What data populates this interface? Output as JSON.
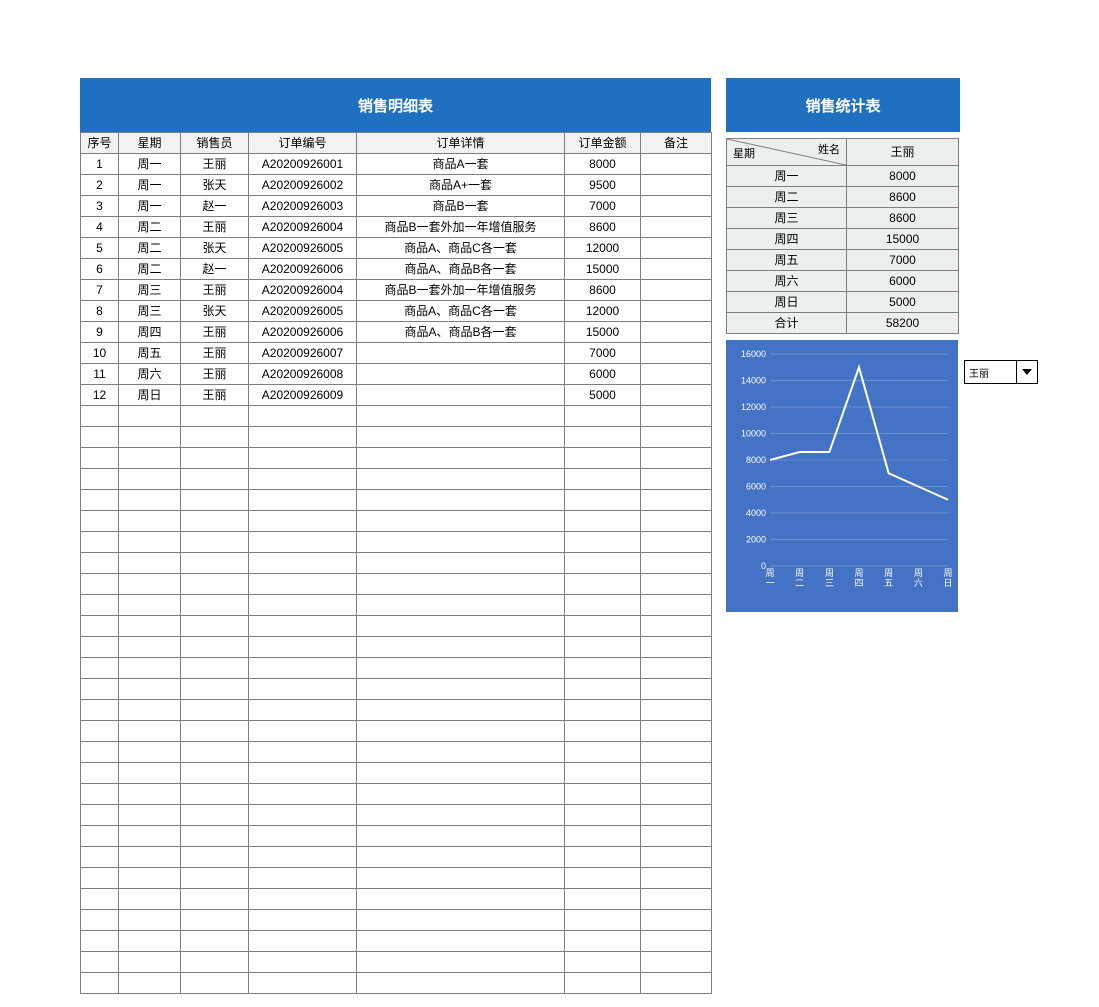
{
  "detail": {
    "title": "销售明细表",
    "headers": [
      "序号",
      "星期",
      "销售员",
      "订单编号",
      "订单详情",
      "订单金额",
      "备注"
    ],
    "rows": [
      {
        "seq": "1",
        "day": "周一",
        "sp": "王丽",
        "ord": "A20200926001",
        "det": "商品A一套",
        "amt": "8000",
        "rem": ""
      },
      {
        "seq": "2",
        "day": "周一",
        "sp": "张天",
        "ord": "A20200926002",
        "det": "商品A+一套",
        "amt": "9500",
        "rem": ""
      },
      {
        "seq": "3",
        "day": "周一",
        "sp": "赵一",
        "ord": "A20200926003",
        "det": "商品B一套",
        "amt": "7000",
        "rem": ""
      },
      {
        "seq": "4",
        "day": "周二",
        "sp": "王丽",
        "ord": "A20200926004",
        "det": "商品B一套外加一年增值服务",
        "amt": "8600",
        "rem": ""
      },
      {
        "seq": "5",
        "day": "周二",
        "sp": "张天",
        "ord": "A20200926005",
        "det": "商品A、商品C各一套",
        "amt": "12000",
        "rem": ""
      },
      {
        "seq": "6",
        "day": "周二",
        "sp": "赵一",
        "ord": "A20200926006",
        "det": "商品A、商品B各一套",
        "amt": "15000",
        "rem": ""
      },
      {
        "seq": "7",
        "day": "周三",
        "sp": "王丽",
        "ord": "A20200926004",
        "det": "商品B一套外加一年增值服务",
        "amt": "8600",
        "rem": ""
      },
      {
        "seq": "8",
        "day": "周三",
        "sp": "张天",
        "ord": "A20200926005",
        "det": "商品A、商品C各一套",
        "amt": "12000",
        "rem": ""
      },
      {
        "seq": "9",
        "day": "周四",
        "sp": "王丽",
        "ord": "A20200926006",
        "det": "商品A、商品B各一套",
        "amt": "15000",
        "rem": ""
      },
      {
        "seq": "10",
        "day": "周五",
        "sp": "王丽",
        "ord": "A20200926007",
        "det": "",
        "amt": "7000",
        "rem": ""
      },
      {
        "seq": "11",
        "day": "周六",
        "sp": "王丽",
        "ord": "A20200926008",
        "det": "",
        "amt": "6000",
        "rem": ""
      },
      {
        "seq": "12",
        "day": "周日",
        "sp": "王丽",
        "ord": "A20200926009",
        "det": "",
        "amt": "5000",
        "rem": ""
      }
    ],
    "empty_rows": 28
  },
  "stats": {
    "title": "销售统计表",
    "diag_top": "姓名",
    "diag_bottom": "星期",
    "person": "王丽",
    "rows": [
      {
        "day": "周一",
        "val": "8000"
      },
      {
        "day": "周二",
        "val": "8600"
      },
      {
        "day": "周三",
        "val": "8600"
      },
      {
        "day": "周四",
        "val": "15000"
      },
      {
        "day": "周五",
        "val": "7000"
      },
      {
        "day": "周六",
        "val": "6000"
      },
      {
        "day": "周日",
        "val": "5000"
      }
    ],
    "total_label": "合计",
    "total_value": "58200"
  },
  "selector": {
    "value": "王丽"
  },
  "chart_data": {
    "type": "line",
    "categories": [
      "周一",
      "周二",
      "周三",
      "周四",
      "周五",
      "周六",
      "周日"
    ],
    "values": [
      8000,
      8600,
      8600,
      15000,
      7000,
      6000,
      5000
    ],
    "ylim": [
      0,
      16000
    ],
    "ystep": 2000,
    "series_name": "王丽"
  }
}
